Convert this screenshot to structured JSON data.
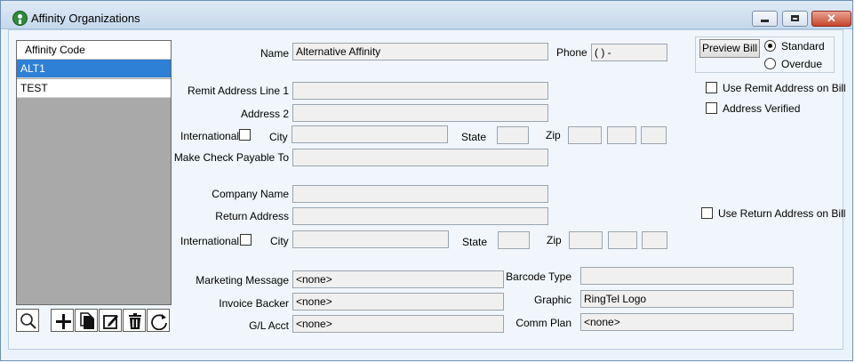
{
  "window": {
    "title": "Affinity Organizations"
  },
  "list": {
    "header": "Affinity Code",
    "rows": [
      {
        "label": "ALT1",
        "selected": true
      },
      {
        "label": "TEST",
        "selected": false
      }
    ]
  },
  "toolbar": {
    "icons": [
      "search-icon",
      "add-icon",
      "copy-icon",
      "edit-icon",
      "delete-icon",
      "refresh-icon"
    ]
  },
  "form": {
    "name_label": "Name",
    "name_value": "Alternative Affinity",
    "phone_label": "Phone",
    "phone_value": "(   )    -",
    "preview_bill": "Preview Bill",
    "standard_label": "Standard",
    "overdue_label": "Overdue",
    "bill_mode": "Standard",
    "remit_line1_label": "Remit Address Line 1",
    "remit_line1_value": "",
    "address2_label": "Address 2",
    "address2_value": "",
    "use_remit_label": "Use Remit Address on Bill",
    "use_remit_checked": false,
    "address_verified_label": "Address Verified",
    "address_verified_checked": false,
    "international_label": "International",
    "international_checked": false,
    "city_label": "City",
    "city_value": "",
    "state_label": "State",
    "state_value": "",
    "zip_label": "Zip",
    "zip_values": [
      "",
      "",
      ""
    ],
    "check_payable_label": "Make Check Payable To",
    "check_payable_value": "",
    "company_name_label": "Company Name",
    "company_name_value": "",
    "return_address_label": "Return Address",
    "return_address_value": "",
    "use_return_label": "Use Return Address on Bill",
    "use_return_checked": false,
    "international2_label": "International",
    "international2_checked": false,
    "city2_label": "City",
    "city2_value": "",
    "state2_label": "State",
    "state2_value": "",
    "zip2_label": "Zip",
    "zip2_values": [
      "",
      "",
      ""
    ],
    "marketing_label": "Marketing Message",
    "marketing_value": "<none>",
    "invoice_backer_label": "Invoice Backer",
    "invoice_backer_value": "<none>",
    "gl_acct_label": "G/L Acct",
    "gl_acct_value": "<none>",
    "barcode_label": "Barcode Type",
    "barcode_value": "",
    "graphic_label": "Graphic",
    "graphic_value": "RingTel Logo",
    "comm_plan_label": "Comm Plan",
    "comm_plan_value": "<none>"
  }
}
